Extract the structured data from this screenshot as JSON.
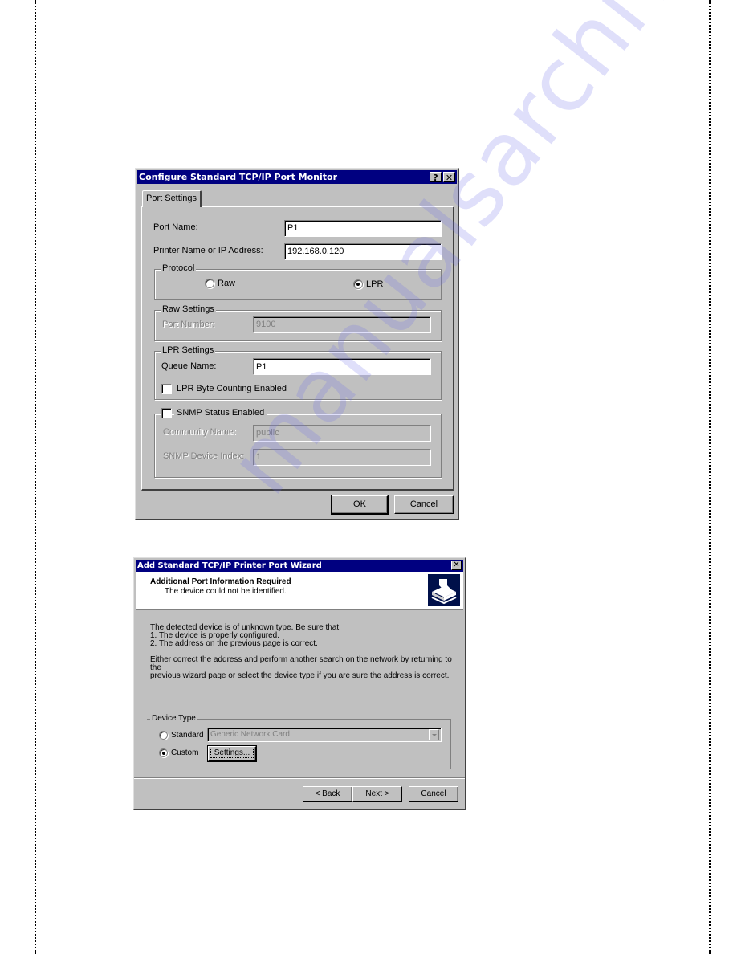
{
  "dialog1": {
    "title": "Configure Standard TCP/IP Port Monitor",
    "help_button": "?",
    "close_button": "✕",
    "tab_label": "Port Settings",
    "port_name_label": "Port Name:",
    "port_name_value": "P1",
    "printer_ip_label": "Printer Name or IP Address:",
    "printer_ip_value": "192.168.0.120",
    "protocol": {
      "legend": "Protocol",
      "options": [
        {
          "label": "Raw",
          "checked": false
        },
        {
          "label": "LPR",
          "checked": true
        }
      ]
    },
    "raw_settings": {
      "legend": "Raw Settings",
      "port_number_label": "Port Number:",
      "port_number_value": "9100"
    },
    "lpr_settings": {
      "legend": "LPR Settings",
      "queue_name_label": "Queue Name:",
      "queue_name_value": "P1",
      "byte_counting_label": "LPR Byte Counting Enabled",
      "byte_counting_checked": false
    },
    "snmp": {
      "legend": "SNMP Status Enabled",
      "checked": false,
      "community_label": "Community Name:",
      "community_value": "public",
      "device_index_label": "SNMP Device Index:",
      "device_index_value": "1"
    },
    "ok_label": "OK",
    "cancel_label": "Cancel"
  },
  "dialog2": {
    "title": "Add Standard TCP/IP Printer Port Wizard",
    "close_button": "✕",
    "header_title": "Additional Port Information Required",
    "header_subtitle": "The device could not be identified.",
    "body_lines": [
      "The detected device is of unknown type.  Be sure that:",
      "1. The device is properly configured.",
      "2.  The address on the previous page is correct."
    ],
    "body_paragraph": [
      "Either correct the address and perform another search on the network by returning to the",
      "previous wizard page or select the device type if you are sure the address is correct."
    ],
    "device_type": {
      "legend": "Device Type",
      "standard_label": "Standard",
      "standard_checked": false,
      "standard_selected": "Generic Network Card",
      "custom_label": "Custom",
      "custom_checked": true,
      "settings_label": "Settings..."
    },
    "back_label": "< Back",
    "next_label": "Next >",
    "cancel_label": "Cancel"
  },
  "watermark": "manualsarchive.com"
}
